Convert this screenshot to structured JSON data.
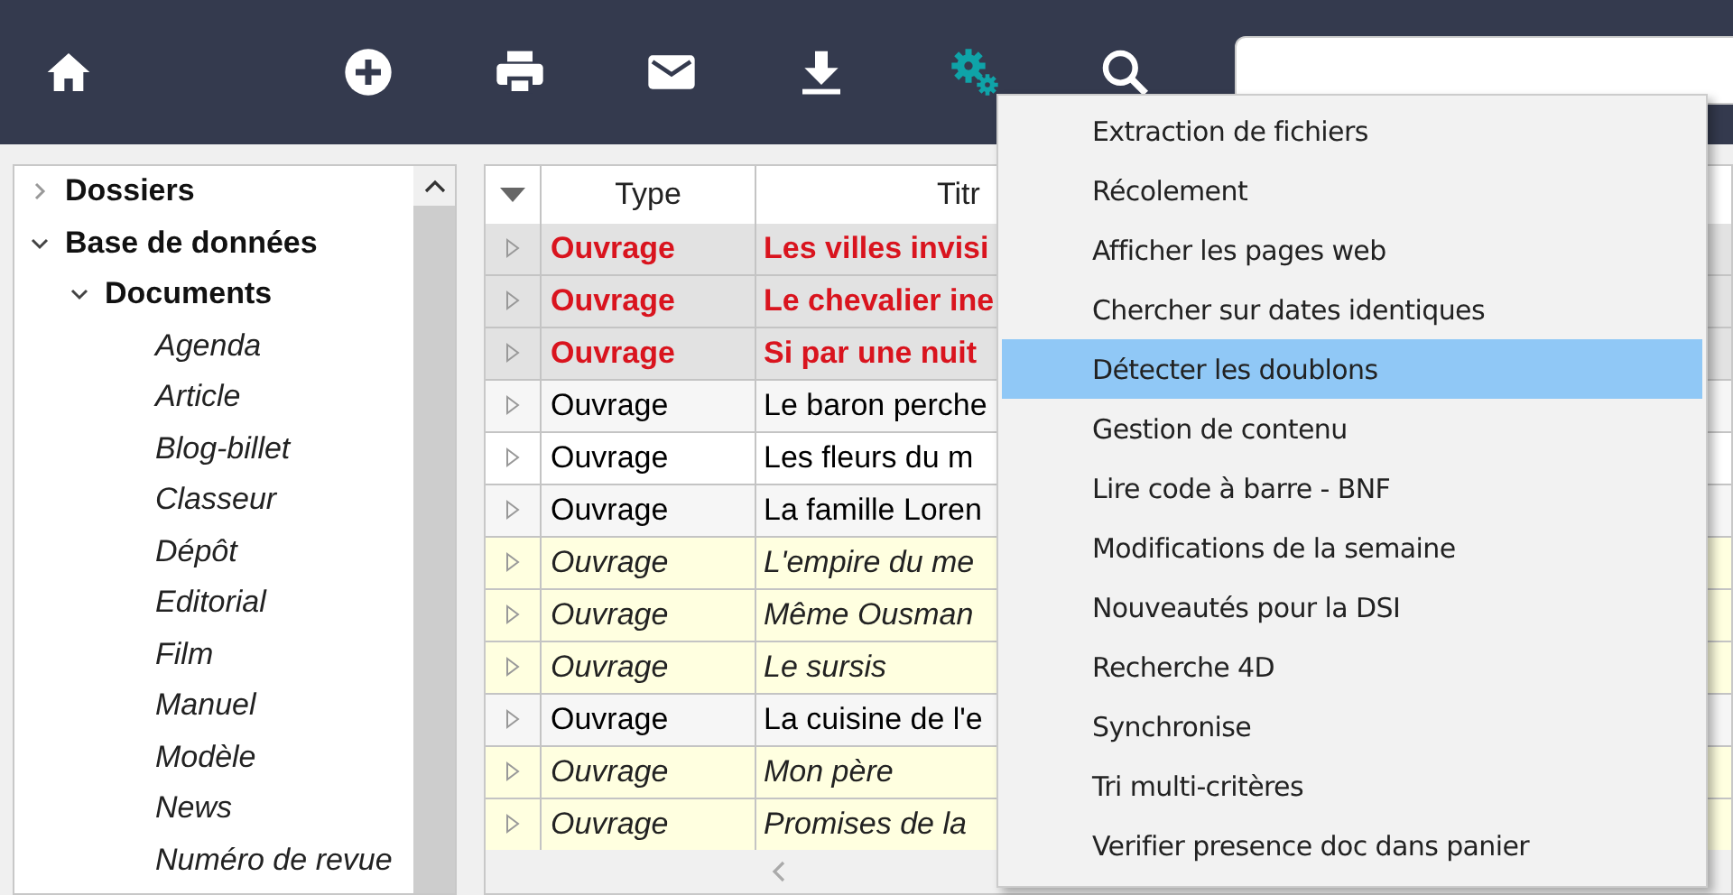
{
  "toolbar": {
    "buttons": [
      {
        "kind": "home",
        "active": false
      },
      {
        "kind": "add",
        "active": false
      },
      {
        "kind": "print",
        "active": false
      },
      {
        "kind": "mail",
        "active": false
      },
      {
        "kind": "download",
        "active": false
      },
      {
        "kind": "gears",
        "active": true
      },
      {
        "kind": "search",
        "active": false
      }
    ]
  },
  "tree": [
    {
      "label": "Dossiers",
      "expanded": false
    },
    {
      "label": "Base de données",
      "expanded": true,
      "children": [
        {
          "label": "Documents",
          "expanded": true,
          "children": [
            {
              "label": "Agenda"
            },
            {
              "label": "Article"
            },
            {
              "label": "Blog-billet"
            },
            {
              "label": "Classeur"
            },
            {
              "label": "Dépôt"
            },
            {
              "label": "Editorial"
            },
            {
              "label": "Film"
            },
            {
              "label": "Manuel"
            },
            {
              "label": "Modèle"
            },
            {
              "label": "News"
            },
            {
              "label": "Numéro de revue"
            }
          ]
        }
      ]
    }
  ],
  "table": {
    "columns": [
      "Type",
      "Titr"
    ],
    "rows": [
      {
        "kind": "duplicate",
        "cells": [
          "Ouvrage",
          "Les villes invisi"
        ]
      },
      {
        "kind": "duplicate",
        "cells": [
          "Ouvrage",
          "Le chevalier ine"
        ]
      },
      {
        "kind": "duplicate",
        "cells": [
          "Ouvrage",
          "Si par une nuit"
        ]
      },
      {
        "kind": "plain",
        "cells": [
          "Ouvrage",
          "Le baron perche"
        ]
      },
      {
        "kind": "plain",
        "cells": [
          "Ouvrage",
          "Les fleurs du m"
        ]
      },
      {
        "kind": "plain",
        "cells": [
          "Ouvrage",
          "La famille Loren"
        ]
      },
      {
        "kind": "draft",
        "cells": [
          "Ouvrage",
          "L'empire du me"
        ]
      },
      {
        "kind": "draft",
        "cells": [
          "Ouvrage",
          "Même Ousman"
        ]
      },
      {
        "kind": "draft",
        "cells": [
          "Ouvrage",
          "Le sursis"
        ]
      },
      {
        "kind": "plain",
        "cells": [
          "Ouvrage",
          "La cuisine de l'e"
        ]
      },
      {
        "kind": "draft",
        "cells": [
          "Ouvrage",
          "Mon père"
        ]
      },
      {
        "kind": "draft",
        "cells": [
          "Ouvrage",
          "Promises de la"
        ]
      }
    ]
  },
  "menu": {
    "items": [
      {
        "label": "Extraction de fichiers",
        "selected": false
      },
      {
        "label": "Récolement",
        "selected": false
      },
      {
        "label": "Afficher les pages web",
        "selected": false
      },
      {
        "label": "Chercher sur dates identiques",
        "selected": false
      },
      {
        "label": "Détecter les doublons",
        "selected": true
      },
      {
        "label": "Gestion de contenu",
        "selected": false
      },
      {
        "label": "Lire code à barre - BNF",
        "selected": false
      },
      {
        "label": "Modifications de la semaine",
        "selected": false
      },
      {
        "label": "Nouveautés pour la DSI",
        "selected": false
      },
      {
        "label": "Recherche 4D",
        "selected": false
      },
      {
        "label": "Synchronise",
        "selected": false
      },
      {
        "label": "Tri multi-critères",
        "selected": false
      },
      {
        "label": "Verifier presence doc dans panier",
        "selected": false
      }
    ]
  }
}
